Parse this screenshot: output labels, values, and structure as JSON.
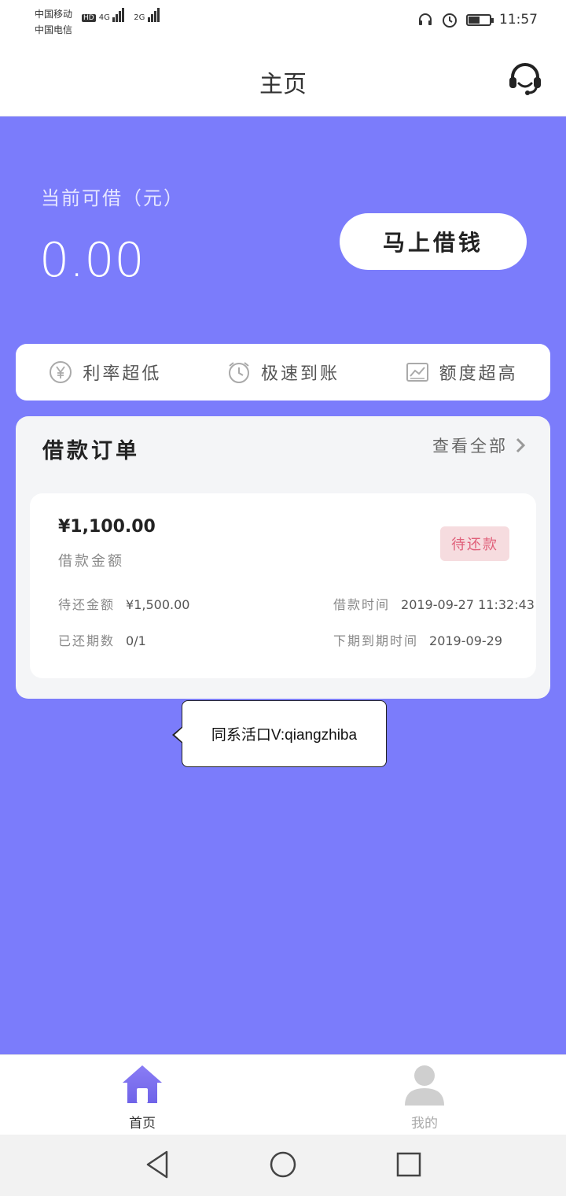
{
  "status_bar": {
    "carrier_1": "中国移动",
    "carrier_2": "中国电信",
    "hd": "HD",
    "net_1": "4G",
    "net_2": "2G",
    "time": "11:57",
    "battery_percent": 50
  },
  "header": {
    "title": "主页"
  },
  "balance": {
    "label": "当前可借（元）",
    "value": "0.00",
    "borrow_button": "马上借钱"
  },
  "features": [
    {
      "icon": "yen-circle-icon",
      "label": "利率超低"
    },
    {
      "icon": "clock-icon",
      "label": "极速到账"
    },
    {
      "icon": "chart-icon",
      "label": "额度超高"
    }
  ],
  "orders": {
    "title": "借款订单",
    "view_all": "查看全部",
    "card": {
      "amount": "¥1,100.00",
      "amount_label": "借款金额",
      "status": "待还款",
      "pending_label": "待还金额",
      "pending_value": "¥1,500.00",
      "time_label": "借款时间",
      "time_value": "2019-09-27 11:32:43",
      "periods_label": "已还期数",
      "periods_value": "0/1",
      "next_due_label": "下期到期时间",
      "next_due_value": "2019-09-29"
    }
  },
  "tooltip": {
    "text": "同系活口V:qiangzhiba"
  },
  "tab_bar": {
    "home": "首页",
    "me": "我的"
  },
  "colors": {
    "primary": "#7b7cfb",
    "badge_bg": "#f6dcdf",
    "badge_text": "#e0607a"
  }
}
